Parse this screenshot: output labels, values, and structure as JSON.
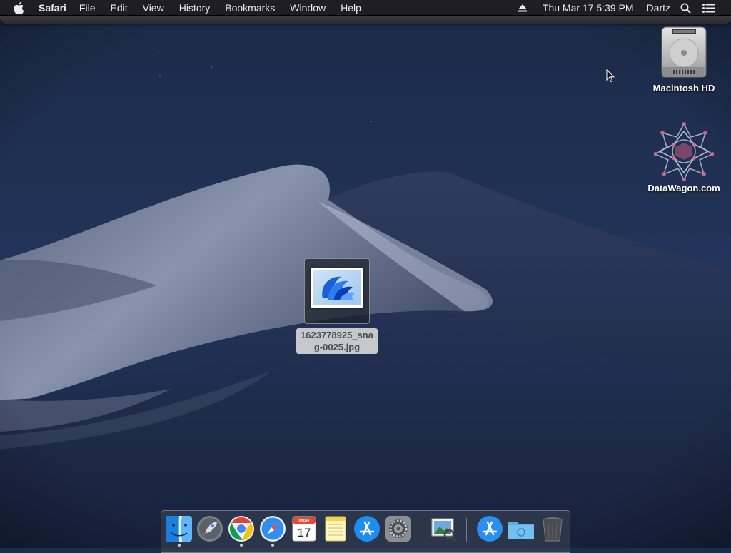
{
  "menubar": {
    "apple_icon": "apple-logo-icon",
    "app_name": "Safari",
    "menus": [
      "File",
      "Edit",
      "View",
      "History",
      "Bookmarks",
      "Window",
      "Help"
    ],
    "clock": "Thu Mar 17  5:39 PM",
    "user": "Dartz",
    "status_icons": [
      "eject-icon",
      "spotlight-search-icon",
      "notification-center-icon"
    ]
  },
  "desktop": {
    "icons": [
      {
        "label": "Macintosh HD",
        "icon": "hard-drive-icon"
      },
      {
        "label": "DataWagon.com",
        "icon": "network-volume-icon"
      }
    ],
    "selected_file": {
      "label": "1623778925_snag-0025.jpg",
      "icon": "image-thumbnail-icon"
    }
  },
  "dock": {
    "items": [
      {
        "name": "Finder",
        "icon": "finder-icon",
        "running": true
      },
      {
        "name": "Launchpad",
        "icon": "launchpad-icon",
        "running": false
      },
      {
        "name": "Google Chrome",
        "icon": "chrome-icon",
        "running": true
      },
      {
        "name": "Safari",
        "icon": "safari-icon",
        "running": true
      },
      {
        "name": "Calendar",
        "icon": "calendar-icon",
        "running": false,
        "month": "MAR",
        "day": "17"
      },
      {
        "name": "Notes",
        "icon": "notes-icon",
        "running": false
      },
      {
        "name": "App Store",
        "icon": "app-store-icon",
        "running": false
      },
      {
        "name": "System Preferences",
        "icon": "system-preferences-icon",
        "running": false
      },
      {
        "name": "Preview",
        "icon": "preview-icon",
        "running": false
      },
      {
        "name": "Applications",
        "icon": "applications-folder-icon",
        "running": false
      },
      {
        "name": "Downloads",
        "icon": "downloads-folder-icon",
        "running": false
      },
      {
        "name": "Trash",
        "icon": "trash-icon",
        "running": false
      }
    ]
  },
  "colors": {
    "menubar_bg": "#1f1f21",
    "sky": "#1d2c48",
    "dune": "#6d7793"
  }
}
